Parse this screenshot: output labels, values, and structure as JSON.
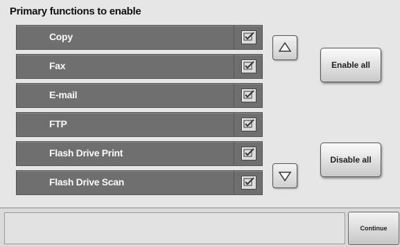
{
  "header": {
    "title": "Primary functions to enable"
  },
  "functions": [
    {
      "label": "Copy",
      "checked": true
    },
    {
      "label": "Fax",
      "checked": true
    },
    {
      "label": "E-mail",
      "checked": true
    },
    {
      "label": "FTP",
      "checked": true
    },
    {
      "label": "Flash Drive Print",
      "checked": true
    },
    {
      "label": "Flash Drive Scan",
      "checked": true
    }
  ],
  "scroll": {
    "up_icon": "arrow-up-icon",
    "down_icon": "arrow-down-icon"
  },
  "actions": {
    "enable_all": "Enable all",
    "disable_all": "Disable all",
    "continue": "Continue"
  },
  "status": {
    "message": ""
  },
  "colors": {
    "row_bg": "#6f6f6f",
    "screen_bg": "#e6e6e6",
    "checkbox_bg": "#dcdcdc"
  }
}
